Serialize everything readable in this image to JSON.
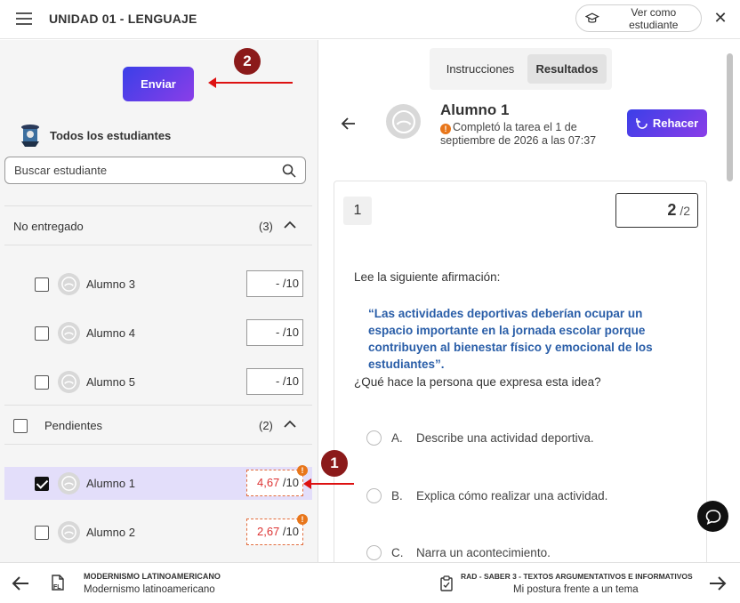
{
  "header": {
    "title": "UNIDAD 01 - LENGUAJE",
    "view_as_student": "Ver como estudiante"
  },
  "left": {
    "send_label": "Enviar",
    "step2": "2",
    "step1": "1",
    "all_students": "Todos los estudiantes",
    "search_placeholder": "Buscar estudiante",
    "sections": [
      {
        "label": "No entregado",
        "count": "(3)",
        "students": [
          {
            "name": "Alumno 3",
            "score": "-",
            "max": "/10"
          },
          {
            "name": "Alumno 4",
            "score": "-",
            "max": "/10"
          },
          {
            "name": "Alumno 5",
            "score": "-",
            "max": "/10"
          }
        ]
      },
      {
        "label": "Pendientes",
        "count": "(2)",
        "students": [
          {
            "name": "Alumno 1",
            "score": "4,67",
            "max": "/10",
            "warn": "!"
          },
          {
            "name": "Alumno 2",
            "score": "2,67",
            "max": "/10",
            "warn": "!"
          }
        ]
      }
    ]
  },
  "right": {
    "tabs": [
      "Instrucciones",
      "Resultados"
    ],
    "student_name": "Alumno 1",
    "warn": "!",
    "completed": "Completó la tarea el 1 de septiembre de 2026 a las 07:37",
    "redo_label": "Rehacer",
    "question": {
      "number": "1",
      "points_got": "2",
      "points_max": "/2",
      "intro": "Lee la siguiente afirmación:",
      "quote": "“Las actividades deportivas deberían ocupar un espacio importante en la jornada escolar porque contribuyen al bienestar físico y emocional de los estudiantes”.",
      "ask": "¿Qué hace la persona que expresa esta idea?",
      "options": [
        {
          "letter": "A.",
          "text": "Describe una actividad deportiva."
        },
        {
          "letter": "B.",
          "text": "Explica cómo realizar una actividad."
        },
        {
          "letter": "C.",
          "text": "Narra un acontecimiento."
        }
      ]
    }
  },
  "footer": {
    "prev_badge": "FL",
    "prev_title": "MODERNISMO LATINOAMERICANO",
    "prev_subtitle": "Modernismo latinoamericano",
    "next_title": "RAD - SABER 3 - TEXTOS ARGUMENTATIVOS E INFORMATIVOS",
    "next_subtitle": "Mi postura frente a un tema"
  },
  "colors": {
    "accent_gradient_start": "#3b3fe8",
    "accent_gradient_end": "#8a3ee8",
    "quote_blue": "#2a5ea8",
    "pending_score_red": "#d33",
    "warning_orange": "#e8761a",
    "step_badge": "#8b1a1a",
    "selected_row": "#e3defa"
  }
}
